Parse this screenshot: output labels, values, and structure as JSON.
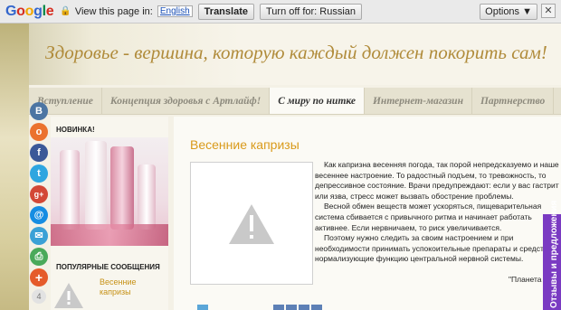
{
  "translate_bar": {
    "logo": [
      "G",
      "o",
      "o",
      "g",
      "l",
      "e"
    ],
    "view_text": "View this page in:",
    "language": "English",
    "translate_label": "Translate",
    "turn_off_label": "Turn off for: Russian",
    "options_label": "Options ▼",
    "close_label": "✕"
  },
  "site": {
    "title": "Здоровье - вершина, которую каждый должен покорить сам!"
  },
  "nav": {
    "tabs": [
      {
        "label": "Вступление"
      },
      {
        "label": "Концепция здоровья с Артлайф!"
      },
      {
        "label": "С миру по нитке"
      },
      {
        "label": "Интернет-магазин"
      },
      {
        "label": "Партнерство"
      }
    ],
    "active_index": 2
  },
  "share_buttons": [
    {
      "icon": "vk-icon",
      "glyph": "В",
      "color": "#4c75a3"
    },
    {
      "icon": "odnoklassniki-icon",
      "glyph": "о",
      "color": "#eb722e"
    },
    {
      "icon": "facebook-icon",
      "glyph": "f",
      "color": "#3b5998"
    },
    {
      "icon": "twitter-icon",
      "glyph": "t",
      "color": "#2ea6e0"
    },
    {
      "icon": "google-plus-icon",
      "glyph": "g+",
      "color": "#d34836"
    },
    {
      "icon": "mail-icon",
      "glyph": "@",
      "color": "#168de2"
    },
    {
      "icon": "email-icon",
      "glyph": "✉",
      "color": "#3ba1d6"
    },
    {
      "icon": "print-icon",
      "glyph": "⎙",
      "color": "#4aa95a"
    },
    {
      "icon": "more-icon",
      "glyph": "+",
      "color": "#e55b2a"
    }
  ],
  "share_count": "4",
  "sidebar": {
    "new_heading": "НОВИНКА!",
    "popular_heading": "ПОПУЛЯРНЫЕ СООБЩЕНИЯ",
    "popular_link": "Весенние капризы"
  },
  "post": {
    "title": "Весенние капризы",
    "paragraphs": [
      "Как капризна весенняя погода, так порой непредсказуемо и наше весеннее настроение.  То  радостный подъем, то тревожность, то депрессивное состояние. Врачи предупреждают: если у вас гастрит или язва, стресс может вызвать обострение проблемы.",
      "Весной обмен веществ может ускоряться, пищеварительная система сбивается с привычного ритма и начинает работать активнее. Если нервничаем, то риск увеличивается.",
      "Поэтому нужно следить за своим настроением и при необходимости принимать успокоительные препараты и средства, нормализующие функцию центральной нервной системы."
    ],
    "signature": "\"Планета А"
  },
  "feedback_label": "Отзывы и предложения"
}
